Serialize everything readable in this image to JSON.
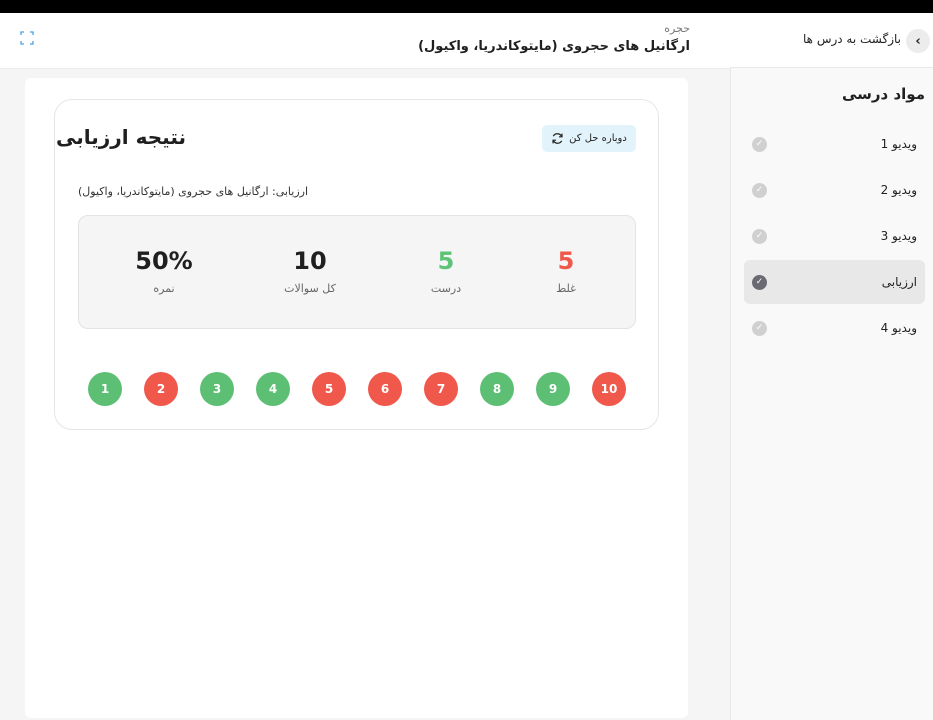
{
  "colors": {
    "correct": "#5cbf74",
    "wrong": "#f0584b",
    "retry_bg": "#e3f3fb"
  },
  "sidebar": {
    "back_label": "بازگشت به درس ها",
    "back_icon": "chevron-left-icon",
    "title": "مواد درسی",
    "items": [
      {
        "label": "ویدیو 1",
        "status": "completed"
      },
      {
        "label": "ویدیو 2",
        "status": "completed"
      },
      {
        "label": "ویدیو 3",
        "status": "completed"
      },
      {
        "label": "ارزیابی",
        "status": "active"
      },
      {
        "label": "ویدیو 4",
        "status": "completed"
      }
    ]
  },
  "header": {
    "crumb": "حجره",
    "title": "ارگانیل های حجروی (مایتوکاندریا، واکیول)",
    "expand_icon": "expand-icon"
  },
  "result": {
    "title": "نتیجه ارزیابی",
    "retry_label": "دوباره حل کن",
    "retry_icon": "refresh-icon",
    "subtitle": "ارزیابی: ارگانیل های حجروی (مایتوکاندریا، واکیول)",
    "stats": {
      "wrong": {
        "value": "5",
        "label": "غلط"
      },
      "right": {
        "value": "5",
        "label": "درست"
      },
      "total": {
        "value": "10",
        "label": "کل سوالات"
      },
      "score": {
        "value": "50%",
        "label": "نمره"
      }
    },
    "answers": [
      {
        "num": "1",
        "correct": true
      },
      {
        "num": "2",
        "correct": false
      },
      {
        "num": "3",
        "correct": true
      },
      {
        "num": "4",
        "correct": true
      },
      {
        "num": "5",
        "correct": false
      },
      {
        "num": "6",
        "correct": false
      },
      {
        "num": "7",
        "correct": false
      },
      {
        "num": "8",
        "correct": true
      },
      {
        "num": "9",
        "correct": true
      },
      {
        "num": "10",
        "correct": false
      }
    ]
  }
}
